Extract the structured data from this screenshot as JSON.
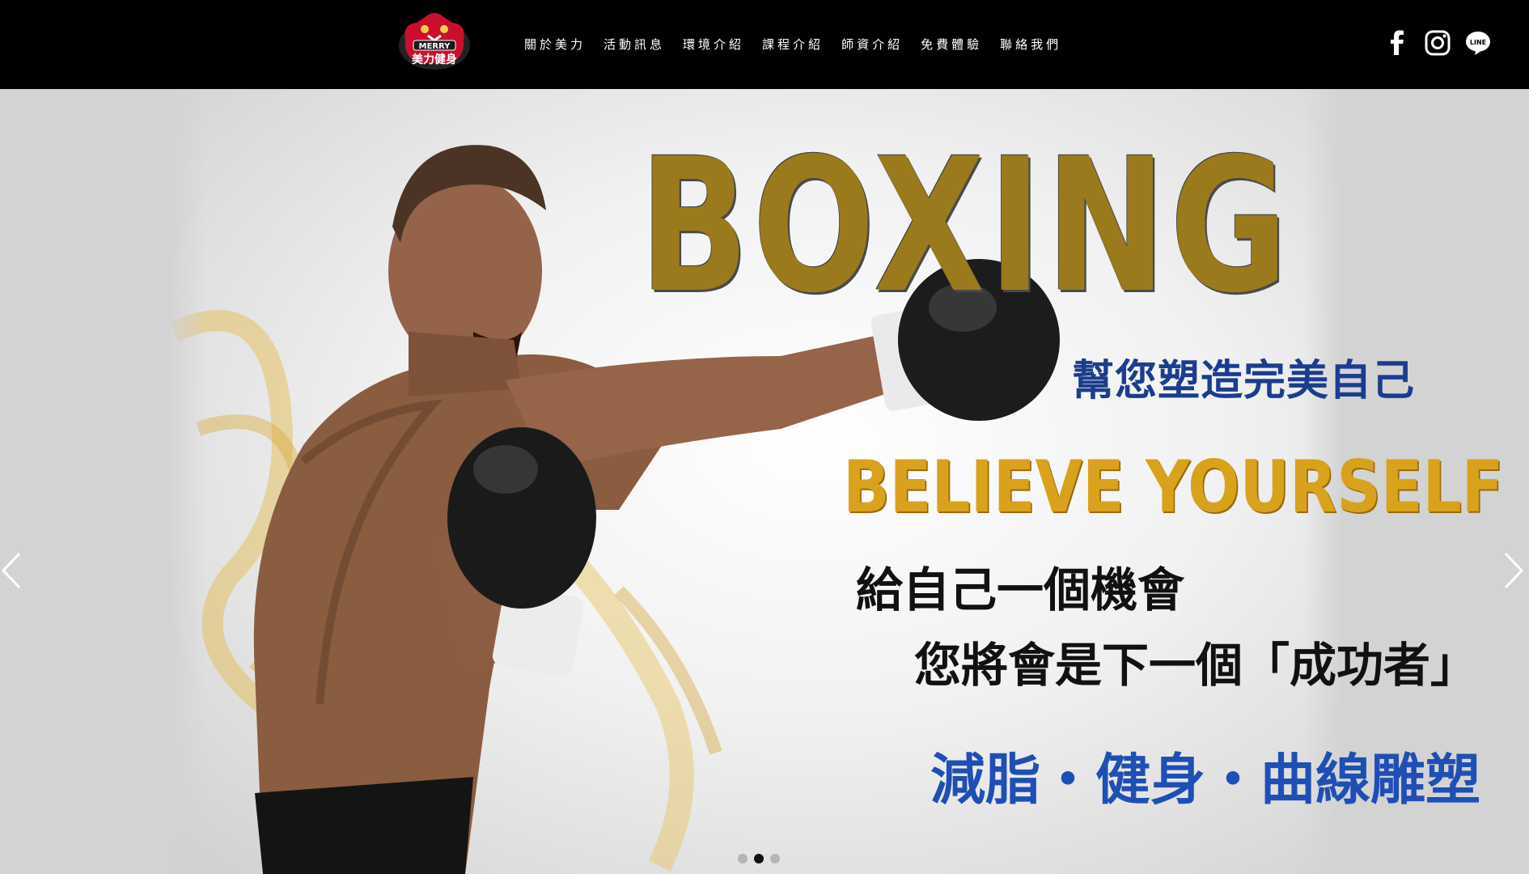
{
  "header": {
    "logo": {
      "text_top": "MERRY",
      "text_bottom": "美力健身",
      "icon": "bear-logo"
    },
    "nav": [
      {
        "label": "關於美力"
      },
      {
        "label": "活動訊息"
      },
      {
        "label": "環境介紹"
      },
      {
        "label": "課程介紹"
      },
      {
        "label": "師資介紹"
      },
      {
        "label": "免費體驗"
      },
      {
        "label": "聯絡我們"
      }
    ],
    "social": [
      {
        "icon": "facebook-icon"
      },
      {
        "icon": "instagram-icon"
      },
      {
        "icon": "line-icon",
        "label": "LINE"
      }
    ]
  },
  "hero": {
    "headline": "BOXING",
    "subtitle": "幫您塑造完美自己",
    "tagline": "BELIEVE YOURSELF",
    "line1": "給自己一個機會",
    "line2": "您將會是下一個「成功者」",
    "line3": "減脂・健身・曲線雕塑",
    "slides": {
      "count": 3,
      "active": 2
    }
  },
  "colors": {
    "header_bg": "#000000",
    "gold": "#d9a21c",
    "blue": "#1b3d8f",
    "accent_red": "#c8102e"
  }
}
